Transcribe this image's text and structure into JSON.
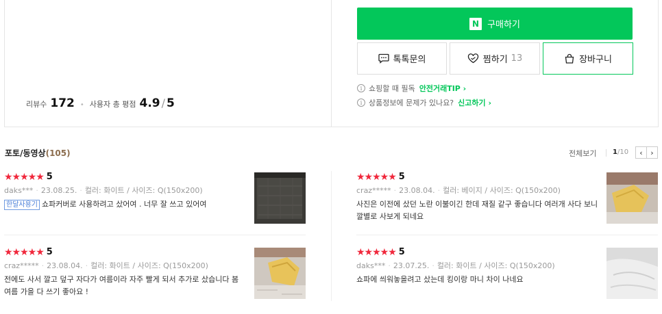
{
  "summary": {
    "review_label": "리뷰수",
    "review_count": "172",
    "rating_label": "사용자 총 평점",
    "rating": "4.9",
    "rating_slash": "/",
    "rating_max": "5"
  },
  "actions": {
    "buy_logo": "N",
    "buy_label": "구매하기",
    "talk_label": "톡톡문의",
    "zzim_label": "찜하기",
    "zzim_count": "13",
    "cart_label": "장바구니",
    "brand_color": "#03c75a"
  },
  "notices": [
    {
      "icon": "i",
      "text": "쇼핑할 때 필독",
      "link": "안전거래TIP ›"
    },
    {
      "icon": "i",
      "text": "상품정보에 문제가 있나요?",
      "link": "신고하기 ›"
    }
  ],
  "photo_reviews": {
    "title": "포토/동영상",
    "count": "(105)",
    "view_all": "전체보기",
    "page_current": "1",
    "page_total": "/10",
    "prev": "‹",
    "next": "›"
  },
  "reviews": [
    {
      "stars": "★★★★★",
      "score": "5",
      "user": "daks***",
      "date": "23.08.25.",
      "option": "컬러: 화이트 / 사이즈: Q(150x200)",
      "badge": "한달사용기",
      "text": "쇼파커버로 사용하려고 샀어여 . 너무 잘 쓰고 있어여",
      "thumb_icon": "grey-fabric-photo"
    },
    {
      "stars": "★★★★★",
      "score": "5",
      "user": "craz*****",
      "date": "23.08.04.",
      "option": "컬러: 베이지 / 사이즈: Q(150x200)",
      "badge": "",
      "text": "사진은 이전에 샀던 노란 이불이긴 한데 재질 같구 좋습니다 여러개 사다 보니 깔별로 사보게 되네요",
      "thumb_icon": "yellow-blanket-photo"
    },
    {
      "stars": "★★★★★",
      "score": "5",
      "user": "craz*****",
      "date": "23.08.04.",
      "option": "컬러: 화이트 / 사이즈: Q(150x200)",
      "badge": "",
      "text": "전에도 사서 깔고 덮구 자다가 여름이라 자주 빨게 되서 추가로 샀습니다 봄 여름 가을 다 쓰기 좋아요 !",
      "thumb_icon": "yellow-blanket-photo"
    },
    {
      "stars": "★★★★★",
      "score": "5",
      "user": "daks***",
      "date": "23.07.25.",
      "option": "컬러: 화이트 / 사이즈: Q(150x200)",
      "badge": "",
      "text": "쇼파에 씌워놓을려고 샀는데 킹이랑 마니 차이 나네요",
      "thumb_icon": "white-fabric-photo"
    }
  ]
}
